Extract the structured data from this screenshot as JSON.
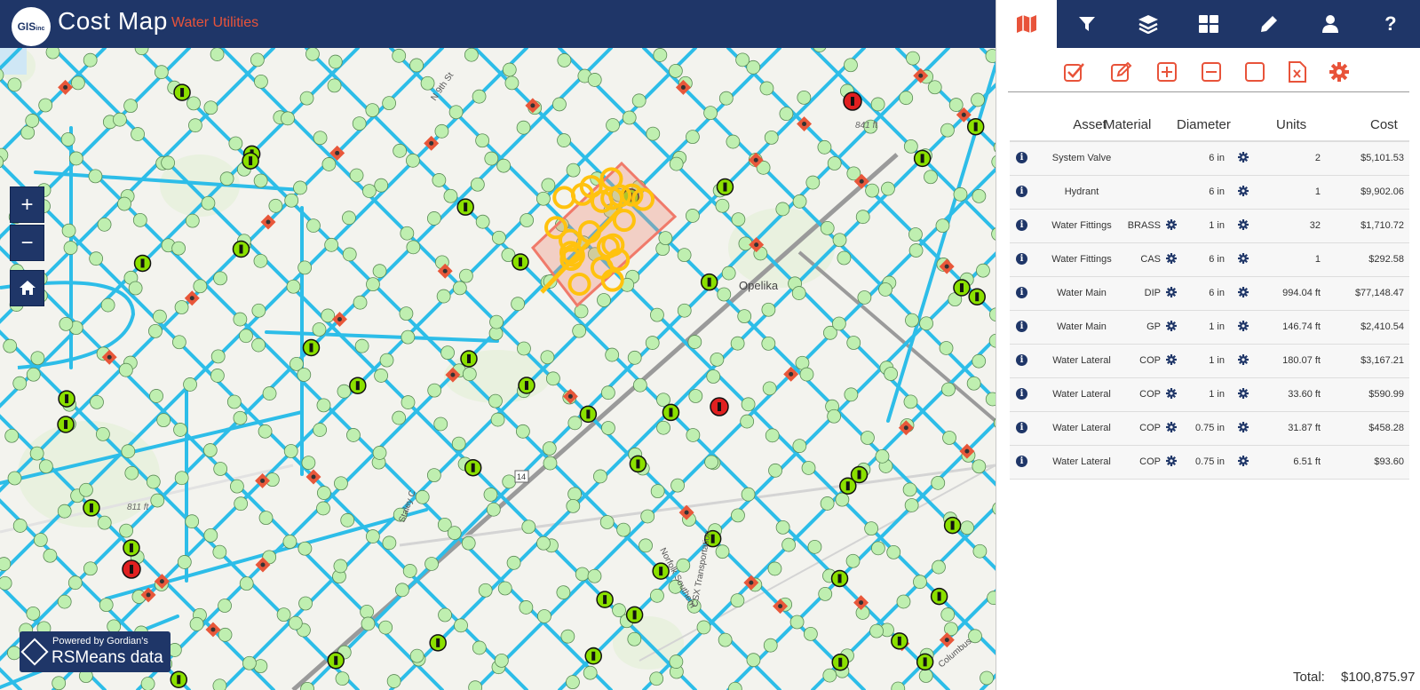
{
  "header": {
    "logo_text": "GIS",
    "logo_sub": "inc",
    "title": "Cost Map",
    "subtitle": "Water Utilities"
  },
  "map": {
    "zoom_in": "+",
    "zoom_out": "−",
    "labels": {
      "street_n9th": "N 9th St",
      "elev_841": "841 ft",
      "elev_811": "811 ft",
      "route_14": "14",
      "opelika": "Opelika",
      "csx": "CSX Transportation",
      "norfolk": "Norfolk Southern",
      "staley": "Staley C",
      "columbus": "Columbus"
    },
    "attribution": {
      "powered_by": "Powered by Gordian's",
      "brand": "RSMeans data"
    }
  },
  "colors": {
    "navy": "#1f3668",
    "accent": "#e8533a",
    "pipe": "#2dbde8",
    "node": "#bfefb0",
    "hydrant": "#8be000",
    "fitting": "#e8573a",
    "selected": "#ffc20e"
  },
  "nav_tabs": [
    {
      "name": "map",
      "label": "map-icon"
    },
    {
      "name": "filter",
      "label": "filter-icon"
    },
    {
      "name": "layers",
      "label": "layers-icon"
    },
    {
      "name": "grid",
      "label": "grid-icon"
    },
    {
      "name": "edit",
      "label": "pencil-icon"
    },
    {
      "name": "user",
      "label": "user-icon"
    },
    {
      "name": "help",
      "label": "?"
    }
  ],
  "toolbar_icons": [
    "check-square-icon",
    "edit-square-icon",
    "plus-square-icon",
    "minus-square-icon",
    "square-icon",
    "excel-icon",
    "gear-icon"
  ],
  "table": {
    "headers": {
      "asset": "Asset",
      "material": "Material",
      "diameter": "Diameter",
      "units": "Units",
      "cost": "Cost"
    },
    "rows": [
      {
        "asset": "System Valve",
        "material": "",
        "diameter": "6 in",
        "units": "2",
        "cost": "$5,101.53"
      },
      {
        "asset": "Hydrant",
        "material": "",
        "diameter": "6 in",
        "units": "1",
        "cost": "$9,902.06"
      },
      {
        "asset": "Water Fittings",
        "material": "BRASS",
        "diameter": "1 in",
        "units": "32",
        "cost": "$1,710.72"
      },
      {
        "asset": "Water Fittings",
        "material": "CAS",
        "diameter": "6 in",
        "units": "1",
        "cost": "$292.58"
      },
      {
        "asset": "Water Main",
        "material": "DIP",
        "diameter": "6 in",
        "units": "994.04 ft",
        "cost": "$77,148.47"
      },
      {
        "asset": "Water Main",
        "material": "GP",
        "diameter": "1 in",
        "units": "146.74 ft",
        "cost": "$2,410.54"
      },
      {
        "asset": "Water Lateral",
        "material": "COP",
        "diameter": "1 in",
        "units": "180.07 ft",
        "cost": "$3,167.21"
      },
      {
        "asset": "Water Lateral",
        "material": "COP",
        "diameter": "1 in",
        "units": "33.60 ft",
        "cost": "$590.99"
      },
      {
        "asset": "Water Lateral",
        "material": "COP",
        "diameter": "0.75 in",
        "units": "31.87 ft",
        "cost": "$458.28"
      },
      {
        "asset": "Water Lateral",
        "material": "COP",
        "diameter": "0.75 in",
        "units": "6.51 ft",
        "cost": "$93.60"
      }
    ],
    "total_label": "Total:",
    "total_value": "$100,875.97"
  }
}
